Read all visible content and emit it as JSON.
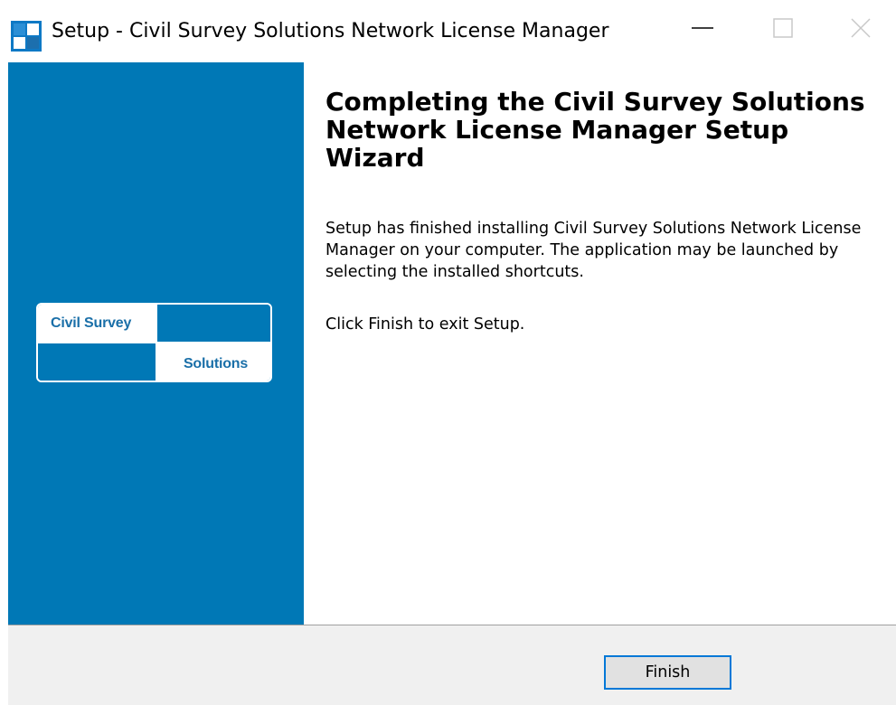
{
  "window": {
    "title": "Setup - Civil Survey Solutions Network License Manager",
    "controls": {
      "minimize": "minimize",
      "maximize": "maximize",
      "close": "close"
    }
  },
  "banner": {
    "logo": {
      "top_left": "Civil Survey",
      "bottom_right": "Solutions"
    },
    "background_color": "#0078b6"
  },
  "content": {
    "heading": "Completing the Civil Survey Solutions Network License Manager Setup Wizard",
    "paragraph_1": "Setup has finished installing Civil Survey Solutions Network License Manager on your computer. The application may be launched by selecting the installed shortcuts.",
    "paragraph_2": "Click Finish to exit Setup."
  },
  "footer": {
    "finish_label": "Finish"
  },
  "colors": {
    "accent": "#0078d7",
    "banner": "#0078b6"
  }
}
